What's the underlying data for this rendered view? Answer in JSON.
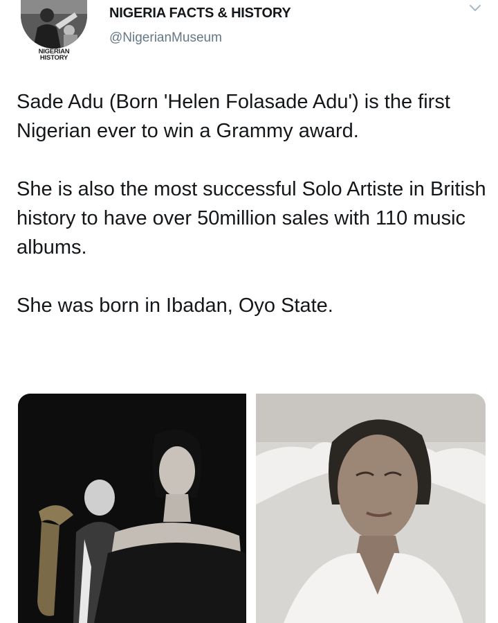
{
  "account": {
    "name": "NIGERIA FACTS & HISTORY",
    "handle": "@NigerianMuseum",
    "avatar_text_line1": "NIGERIAN",
    "avatar_text_line2": "HISTORY"
  },
  "tweet": {
    "paragraphs": [
      "Sade Adu (Born 'Helen Folasade Adu') is the first Nigerian ever to win a Grammy award.",
      "She is also the most successful Solo Artiste in British history to have over 50million sales with 110 music albums.",
      "She was born in Ibadan, Oyo State."
    ]
  },
  "icons": {
    "menu": "chevron-down-icon"
  },
  "colors": {
    "text": "#14171a",
    "handle": "#657786",
    "chevron": "#aab8c2"
  }
}
